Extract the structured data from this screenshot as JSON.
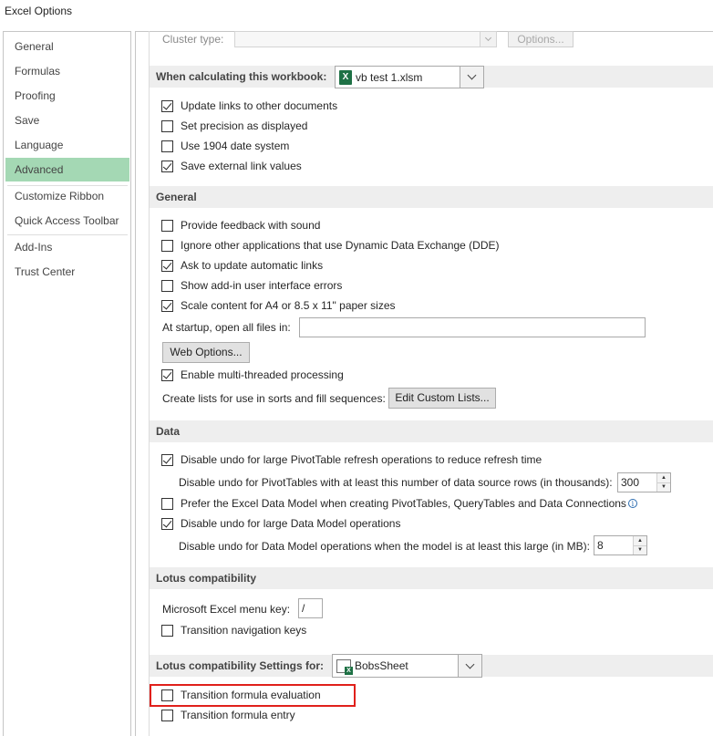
{
  "window": {
    "title": "Excel Options"
  },
  "sidebar": {
    "items": [
      {
        "label": "General"
      },
      {
        "label": "Formulas"
      },
      {
        "label": "Proofing"
      },
      {
        "label": "Save"
      },
      {
        "label": "Language"
      },
      {
        "label": "Advanced"
      },
      {
        "label": "Customize Ribbon"
      },
      {
        "label": "Quick Access Toolbar"
      },
      {
        "label": "Add-Ins"
      },
      {
        "label": "Trust Center"
      }
    ],
    "selected": "Advanced"
  },
  "cluster": {
    "label": "Cluster type:",
    "options_button": "Options..."
  },
  "calc_workbook": {
    "header": "When calculating this workbook:",
    "workbook": "vb test 1.xlsm",
    "options": [
      {
        "label": "Update links to other documents",
        "checked": true
      },
      {
        "label": "Set precision as displayed",
        "checked": false
      },
      {
        "label": "Use 1904 date system",
        "checked": false
      },
      {
        "label": "Save external link values",
        "checked": true
      }
    ]
  },
  "general": {
    "header": "General",
    "options": [
      {
        "label": "Provide feedback with sound",
        "checked": false
      },
      {
        "label": "Ignore other applications that use Dynamic Data Exchange (DDE)",
        "checked": false
      },
      {
        "label": "Ask to update automatic links",
        "checked": true
      },
      {
        "label": "Show add-in user interface errors",
        "checked": false
      },
      {
        "label": "Scale content for A4 or 8.5 x 11\" paper sizes",
        "checked": true
      }
    ],
    "startup_label": "At startup, open all files in:",
    "startup_value": "",
    "web_options_button": "Web Options...",
    "multithreaded": {
      "label": "Enable multi-threaded processing",
      "checked": true
    },
    "custom_lists_label": "Create lists for use in sorts and fill sequences:",
    "custom_lists_button": "Edit Custom Lists..."
  },
  "data": {
    "header": "Data",
    "undo_pivot": {
      "label": "Disable undo for large PivotTable refresh operations to reduce refresh time",
      "checked": true
    },
    "undo_pivot_rows_label": "Disable undo for PivotTables with at least this number of data source rows (in thousands):",
    "undo_pivot_rows_value": "300",
    "prefer_model": {
      "label": "Prefer the Excel Data Model when creating PivotTables, QueryTables and Data Connections",
      "checked": false
    },
    "undo_model": {
      "label": "Disable undo for large Data Model operations",
      "checked": true
    },
    "undo_model_size_label": "Disable undo for Data Model operations when the model is at least this large (in MB):",
    "undo_model_size_value": "8"
  },
  "lotus": {
    "header": "Lotus compatibility",
    "menu_key_label": "Microsoft Excel menu key:",
    "menu_key_value": "/",
    "transition_nav": {
      "label": "Transition navigation keys",
      "checked": false
    }
  },
  "lotus_settings": {
    "header": "Lotus compatibility Settings for:",
    "sheet": "BobsSheet",
    "transition_formula_eval": {
      "label": "Transition formula evaluation",
      "checked": false
    },
    "transition_formula_entry": {
      "label": "Transition formula entry",
      "checked": false
    }
  },
  "colors": {
    "selected_nav": "#a4d8b4",
    "highlight_box": "#e0201b",
    "excel_green": "#1e7145"
  }
}
